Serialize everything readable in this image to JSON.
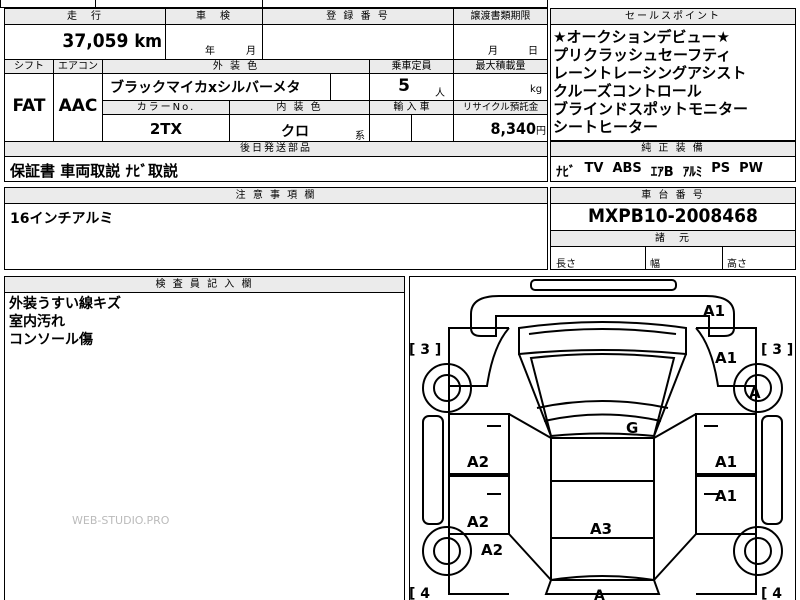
{
  "header": {
    "mileage_label": "走　行",
    "inspection_label": "車　検",
    "registration_label": "登 録 番 号",
    "transfer_label": "譲渡書類期限",
    "sales_point_label": "セールスポイント"
  },
  "mileage": {
    "value": "37,059",
    "unit": "km"
  },
  "inspection": {
    "year_label": "年",
    "month_label": "月"
  },
  "transfer": {
    "month_label": "月",
    "day_label": "日"
  },
  "sales_points": [
    "★オークションデビュー★",
    "プリクラッシュセーフティ",
    "レーントレーシングアシスト",
    "クルーズコントロール",
    "ブラインドスポットモニター",
    "シートヒーター"
  ],
  "row2": {
    "shift_label": "シフト",
    "ac_label": "エアコン",
    "exterior_label": "外 装 色",
    "capacity_label": "乗車定員",
    "payload_label": "最大積載量",
    "shift": "FAT",
    "ac": "AAC",
    "exterior_color": "ブラックマイカxシルバーメタ",
    "capacity": "5",
    "capacity_unit": "人",
    "payload_unit": "kg",
    "color_no_label": "カラーNo.",
    "interior_label": "内 装 色",
    "import_label": "輸 入 車",
    "recycle_label": "リサイクル預託金",
    "color_no": "2TX",
    "interior_color": "クロ",
    "interior_suffix": "系",
    "recycle": "8,340",
    "recycle_unit": "円"
  },
  "accessories": {
    "label": "後日発送部品",
    "value": "保証書 車両取説 ﾅﾋﾞ取説"
  },
  "equipment": {
    "label": "純 正 装 備",
    "items": [
      "ﾅﾋﾞ",
      "TV",
      "ABS",
      "ｴｱB",
      "ｱﾙﾐ",
      "PS",
      "PW"
    ]
  },
  "notes": {
    "label": "注 意 事 項 欄",
    "value": "16インチアルミ"
  },
  "chassis": {
    "label": "車 台 番 号",
    "value": "MXPB10-2008468"
  },
  "dimensions": {
    "label": "諸　元",
    "length": "長さ",
    "width": "幅",
    "height": "高さ"
  },
  "inspector": {
    "label": "検 査 員 記 入 欄",
    "lines": [
      "外装うすい線キズ",
      "室内汚れ",
      "コンソール傷"
    ]
  },
  "watermark": "WEB-STUDIO.PRO",
  "diagram": {
    "marks": {
      "front_right_top": "A1",
      "right_fender": "A1",
      "right_wheel": "A",
      "windshield": "G",
      "left_front_door": "A2",
      "right_front_door": "A1",
      "right_rear_door": "A1",
      "left_rear_door": "A2",
      "left_quarter": "A2",
      "roof": "A3",
      "rear": "A"
    },
    "seat_left_top": "[ 3 ]",
    "seat_right_top": "[ 3 ]",
    "seat_left_bottom": "[ 4",
    "seat_right_bottom": "[ 4"
  }
}
